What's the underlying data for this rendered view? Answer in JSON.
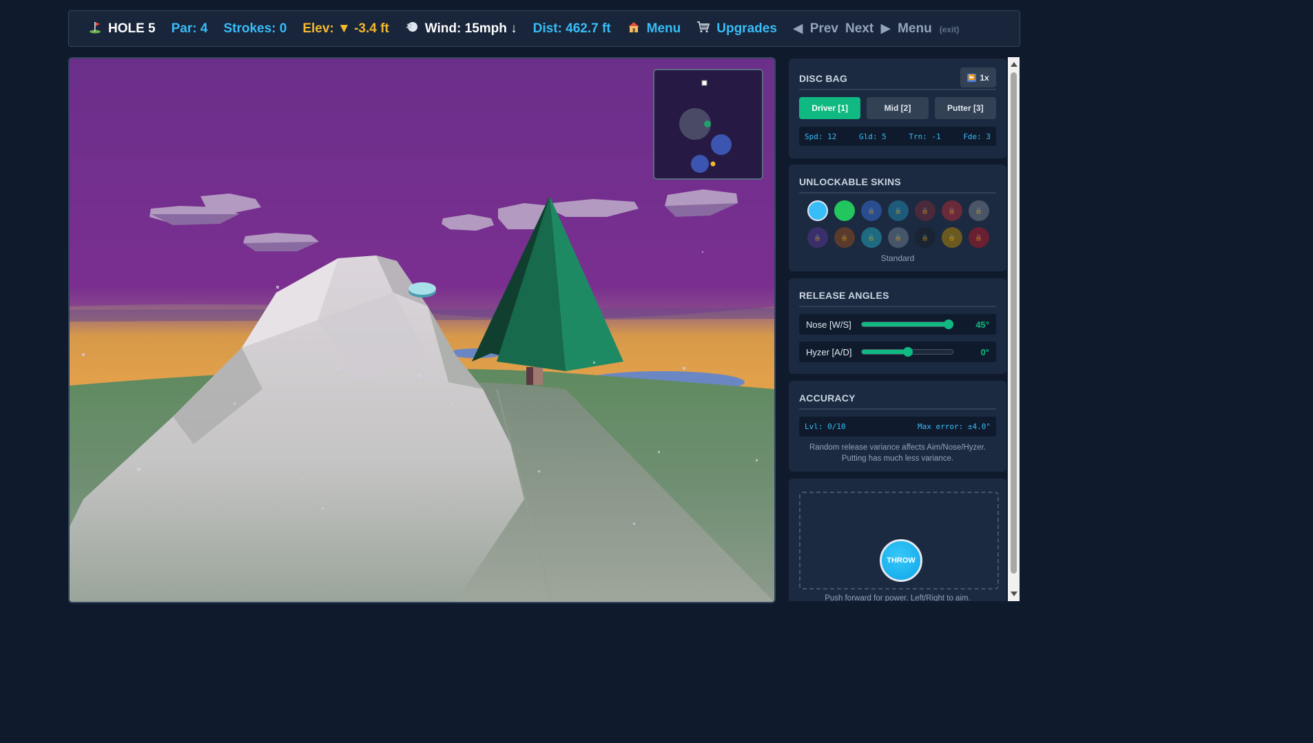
{
  "hud": {
    "hole": "HOLE 5",
    "par": "Par: 4",
    "strokes": "Strokes: 0",
    "elev": "Elev: ▼ -3.4 ft",
    "wind": "Wind: 15mph ↓",
    "dist": "Dist: 462.7 ft",
    "menu": "Menu",
    "upgrades": "Upgrades",
    "prev": "Prev",
    "next": "Next",
    "exit_menu": "Menu",
    "exit_note": "(exit)"
  },
  "icons": {
    "hole": "flag-icon",
    "wind": "wind-icon",
    "menu": "house-icon",
    "upgrades": "cart-icon"
  },
  "disc_bag": {
    "title": "DISC BAG",
    "speed": "1x",
    "types": [
      {
        "label": "Driver [1]",
        "active": true
      },
      {
        "label": "Mid [2]",
        "active": false
      },
      {
        "label": "Putter [3]",
        "active": false
      }
    ],
    "stats": {
      "spd": "Spd: 12",
      "gld": "Gld: 5",
      "trn": "Trn: -1",
      "fde": "Fde: 3"
    }
  },
  "skins": {
    "title": "UNLOCKABLE SKINS",
    "selected_name": "Standard",
    "items": [
      {
        "color": "#38bdf8",
        "locked": false,
        "selected": true
      },
      {
        "color": "#22c55e",
        "locked": false,
        "selected": false
      },
      {
        "color": "#2a4d8f",
        "locked": true,
        "selected": false
      },
      {
        "color": "#1e5a7a",
        "locked": true,
        "selected": false
      },
      {
        "color": "#4a2a3a",
        "locked": true,
        "selected": false
      },
      {
        "color": "#6a2a3a",
        "locked": true,
        "selected": false
      },
      {
        "color": "#4a5568",
        "locked": true,
        "selected": false
      },
      {
        "color": "#3b2f6b",
        "locked": true,
        "selected": false
      },
      {
        "color": "#5a3a2a",
        "locked": true,
        "selected": false
      },
      {
        "color": "#1e6a80",
        "locked": true,
        "selected": false
      },
      {
        "color": "#475569",
        "locked": true,
        "selected": false
      },
      {
        "color": "#1a2332",
        "locked": true,
        "selected": false
      },
      {
        "color": "#6b5a20",
        "locked": true,
        "selected": false
      },
      {
        "color": "#6a2030",
        "locked": true,
        "selected": false
      }
    ]
  },
  "release_angles": {
    "title": "RELEASE ANGLES",
    "nose": {
      "label": "Nose [W/S]",
      "value": "45°",
      "fraction": 0.94
    },
    "hyzer": {
      "label": "Hyzer [A/D]",
      "value": "0°",
      "fraction": 0.5
    }
  },
  "accuracy": {
    "title": "ACCURACY",
    "level": "Lvl: 0/10",
    "max_error": "Max error: ±4.0°",
    "note": "Random release variance affects Aim/Nose/Hyzer. Putting has much less variance."
  },
  "throw": {
    "button": "THROW",
    "hint": "Push forward for power. Left/Right to aim."
  }
}
